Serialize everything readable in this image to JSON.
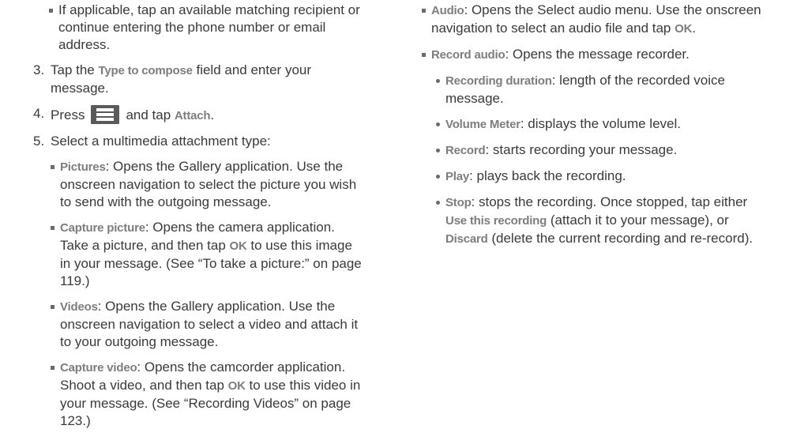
{
  "left": {
    "intro": "If applicable, tap an available matching recipient or continue entering the phone number or email address.",
    "step3": {
      "num": "3.",
      "a": "Tap the ",
      "b": "Type to compose",
      "c": " field and enter your message."
    },
    "step4": {
      "num": "4.",
      "a": "Press",
      "icon": "menu-key-icon",
      "c": "and tap ",
      "b": "Attach",
      "d": "."
    },
    "step5": {
      "num": "5.",
      "text": "Select a multimedia attachment type:"
    },
    "pictures": {
      "term": "Pictures",
      "text": ": Opens the Gallery application. Use the onscreen navigation to select the picture you wish to send with the outgoing message."
    },
    "capture_picture": {
      "term": "Capture picture",
      "a": ": Opens the camera application. Take a picture, and then tap ",
      "ok": "OK",
      "b": " to use this image in your message. (See “To take a picture:” on page 119.)"
    },
    "videos": {
      "term": "Videos",
      "text": ": Opens the Gallery application. Use the onscreen navigation to select a video and attach it to your outgoing message."
    },
    "capture_video": {
      "term": "Capture video",
      "a": ": Opens the camcorder application. Shoot a video, and then tap ",
      "ok": "OK",
      "b": " to use this video in your message. (See “Recording Videos” on page 123.)"
    }
  },
  "right": {
    "audio": {
      "term": "Audio",
      "a": ": Opens the Select audio menu. Use the onscreen navigation to select an audio file and tap ",
      "ok": "OK",
      "b": "."
    },
    "record_audio": {
      "term": "Record audio",
      "text": ": Opens the message recorder."
    },
    "recording_duration": {
      "term": "Recording duration",
      "text": ": length of the recorded voice message."
    },
    "volume_meter": {
      "term": "Volume Meter",
      "text": ": displays the volume level."
    },
    "record": {
      "term": "Record",
      "text": ": starts recording your message."
    },
    "play": {
      "term": "Play",
      "text": ": plays back the recording."
    },
    "stop": {
      "term": "Stop",
      "a": ": stops the recording. Once stopped, tap either ",
      "use": "Use this recording",
      "b": " (attach it to your message), or ",
      "discard": "Discard",
      "c": " (delete the current recording and re-record)."
    }
  }
}
